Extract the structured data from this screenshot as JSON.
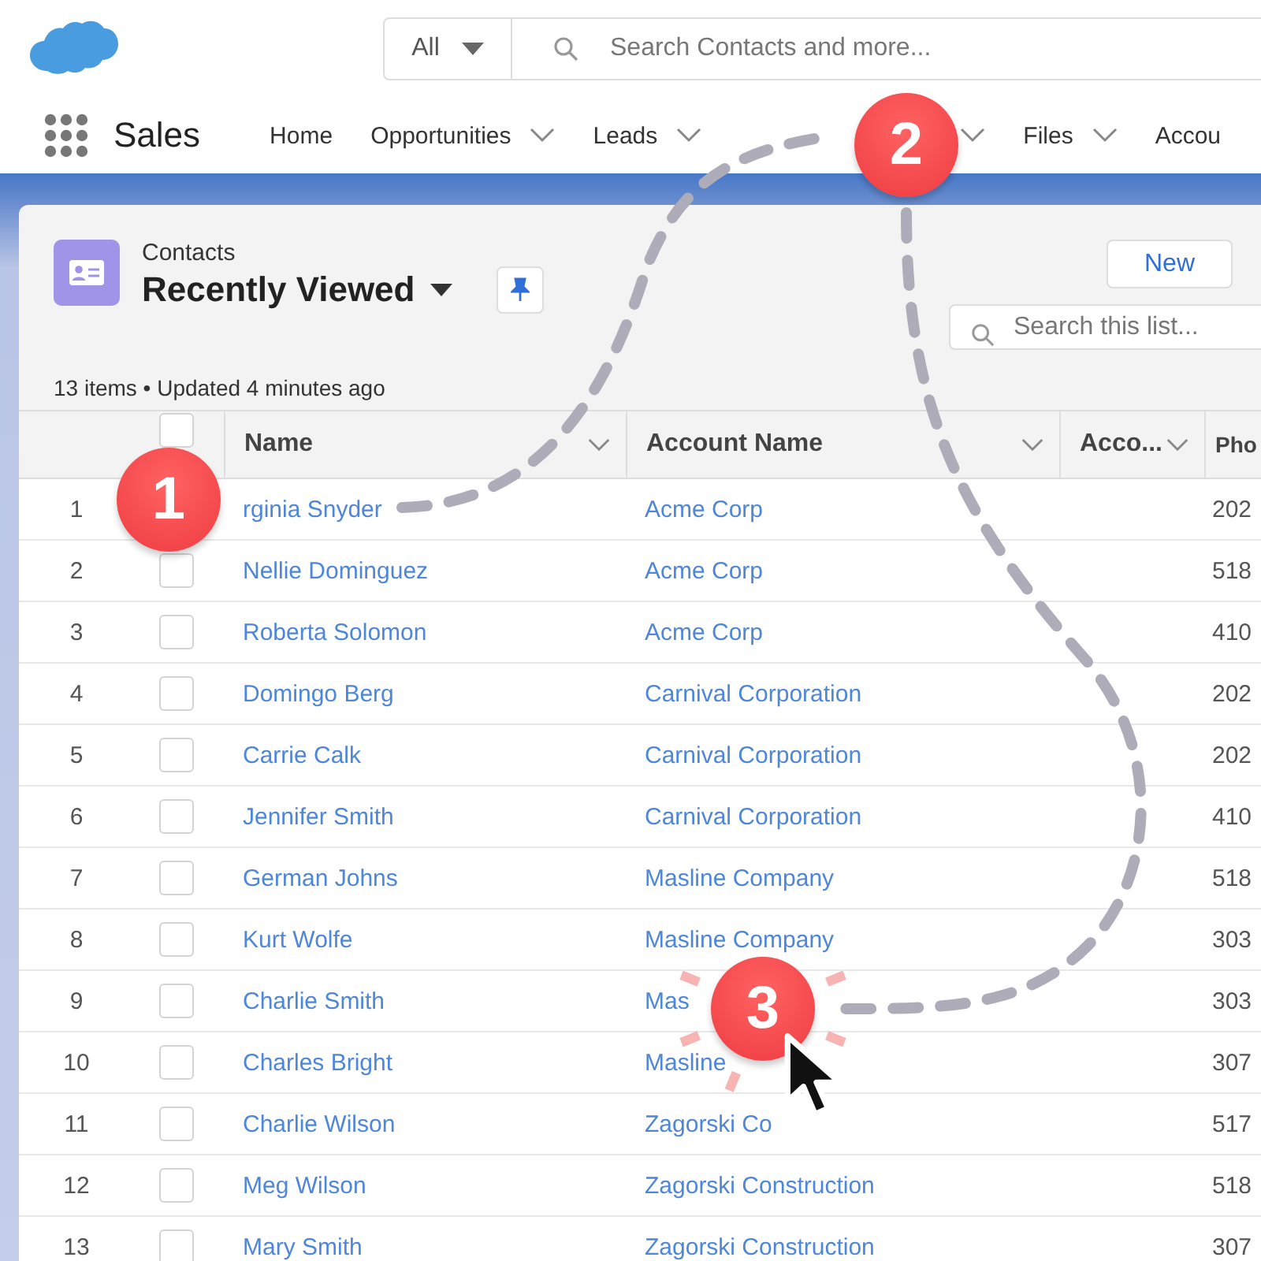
{
  "global_search": {
    "scope": "All",
    "placeholder": "Search Contacts and more..."
  },
  "app_name": "Sales",
  "nav_tabs": [
    {
      "label": "Home",
      "dropdown": false
    },
    {
      "label": "Opportunities",
      "dropdown": true
    },
    {
      "label": "Leads",
      "dropdown": true
    },
    {
      "dropdown": true
    },
    {
      "label": "Files",
      "dropdown": true
    },
    {
      "label": "Accou",
      "dropdown": false
    }
  ],
  "list_header": {
    "object": "Contacts",
    "view": "Recently Viewed",
    "status": "13 items • Updated 4 minutes ago",
    "new_button": "New",
    "search_placeholder": "Search this list..."
  },
  "table": {
    "select_all_checked": false,
    "columns": [
      "Name",
      "Account Name",
      "Acco...",
      "Pho"
    ],
    "rows": [
      {
        "number": "1",
        "name": "rginia Snyder",
        "account": "Acme Corp",
        "phone": "202"
      },
      {
        "number": "2",
        "checked": false,
        "name": "Nellie Dominguez",
        "account": "Acme Corp",
        "phone": "518"
      },
      {
        "number": "3",
        "checked": false,
        "name": "Roberta Solomon",
        "account": "Acme Corp",
        "phone": "410"
      },
      {
        "number": "4",
        "checked": false,
        "name": "Domingo Berg",
        "account": "Carnival Corporation",
        "phone": "202"
      },
      {
        "number": "5",
        "checked": false,
        "name": "Carrie Calk",
        "account": "Carnival Corporation",
        "phone": "202"
      },
      {
        "number": "6",
        "checked": false,
        "name": "Jennifer Smith",
        "account": "Carnival Corporation",
        "phone": "410"
      },
      {
        "number": "7",
        "checked": false,
        "name": "German Johns",
        "account": "Masline Company",
        "phone": "518"
      },
      {
        "number": "8",
        "checked": false,
        "name": "Kurt Wolfe",
        "account": "Masline Company",
        "phone": "303"
      },
      {
        "number": "9",
        "checked": false,
        "name": "Charlie Smith",
        "account": "Mas",
        "phone": "303"
      },
      {
        "number": "10",
        "checked": false,
        "name": "Charles Bright",
        "account": "Masline",
        "phone": "307"
      },
      {
        "number": "11",
        "checked": false,
        "name": "Charlie Wilson",
        "account": "Zagorski Co",
        "phone": "517"
      },
      {
        "number": "12",
        "checked": false,
        "name": "Meg Wilson",
        "account": "Zagorski Construction",
        "phone": "518"
      },
      {
        "number": "13",
        "checked": false,
        "name": "Mary Smith",
        "account": "Zagorski Construction",
        "phone": "307"
      }
    ]
  },
  "step_markers": [
    {
      "label": "1",
      "clicked": false
    },
    {
      "label": "2",
      "clicked": false
    },
    {
      "label": "3",
      "clicked": true
    }
  ]
}
